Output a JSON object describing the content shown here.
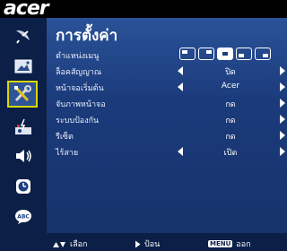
{
  "brand": {
    "logo_text": "acer"
  },
  "sidebar": {
    "items": [
      {
        "icon": "satellite-dish-icon"
      },
      {
        "icon": "picture-icon"
      },
      {
        "icon": "wrench-screwdriver-icon",
        "selected": true
      },
      {
        "icon": "projector-settings-icon"
      },
      {
        "icon": "speaker-icon"
      },
      {
        "icon": "clock-icon"
      },
      {
        "icon": "language-abc-icon"
      }
    ]
  },
  "main": {
    "title": "การตั้งค่า",
    "rows": [
      {
        "label": "ตำแหน่งเมนู",
        "type": "position-icons",
        "selected_index": 2
      },
      {
        "label": "ล็อคสัญญาณ",
        "value": "ปิด",
        "arrows": true
      },
      {
        "label": "หน้าจอเริ่มต้น",
        "value": "Acer",
        "arrows": true
      },
      {
        "label": "จับภาพหน้าจอ",
        "value": "กด",
        "arrows": false
      },
      {
        "label": "ระบบป้องกัน",
        "value": "กด",
        "arrows": false
      },
      {
        "label": "รีเซ็ต",
        "value": "กด",
        "arrows": false
      },
      {
        "label": "ไร้สาย",
        "value": "เปิด",
        "arrows": true
      }
    ]
  },
  "bottombar": {
    "select_label": "เลือก",
    "enter_label": "ป้อน",
    "menu_key": "MENU",
    "exit_label": "ออก"
  }
}
